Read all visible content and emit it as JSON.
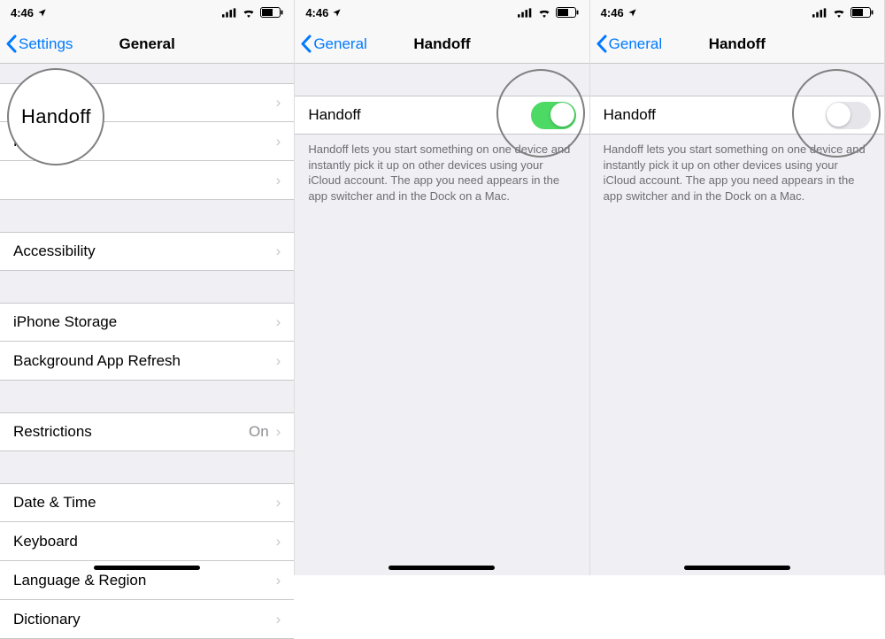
{
  "status": {
    "time": "4:46",
    "location_icon": "location-icon"
  },
  "panel1": {
    "back_label": "Settings",
    "title": "General",
    "rows_top": [
      "Handoff"
    ],
    "accessibility": "Accessibility",
    "storage_group": [
      "iPhone Storage",
      "Background App Refresh"
    ],
    "restrictions": {
      "label": "Restrictions",
      "value": "On"
    },
    "bottom_group": [
      "Date & Time",
      "Keyboard",
      "Language & Region",
      "Dictionary"
    ],
    "callout_label": "Handoff"
  },
  "panel2": {
    "back_label": "General",
    "title": "Handoff",
    "row_label": "Handoff",
    "toggle_on": true,
    "footer": "Handoff lets you start something on one device and instantly pick it up on other devices using your iCloud account. The app you need appears in the app switcher and in the Dock on a Mac."
  },
  "panel3": {
    "back_label": "General",
    "title": "Handoff",
    "row_label": "Handoff",
    "toggle_on": false,
    "footer": "Handoff lets you start something on one device and instantly pick it up on other devices using your iCloud account. The app you need appears in the app switcher and in the Dock on a Mac."
  }
}
